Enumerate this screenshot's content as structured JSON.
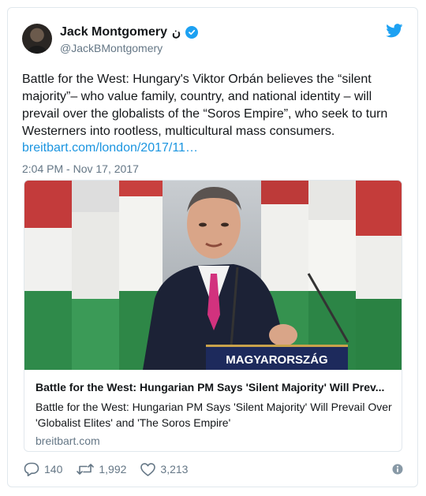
{
  "author": {
    "name": "Jack Montgomery",
    "name_suffix": "ن",
    "handle": "@JackBMontgomery"
  },
  "tweet": {
    "text": "Battle for the West: Hungary's Viktor Orbán believes the “silent majority”– who value family, country, and national identity – will prevail over the globalists of the “Soros Empire”, who seek to turn Westerners into rootless, multicultural mass consumers.",
    "link": "breitbart.com/london/2017/11…",
    "timestamp": "2:04 PM - Nov 17, 2017"
  },
  "card": {
    "podium_text": "MAGYARORSZÁG",
    "title": "Battle for the West: Hungarian PM Says 'Silent Majority' Will Prev...",
    "description": "Battle for the West: Hungarian PM Says 'Silent Majority' Will Prevail Over 'Globalist Elites' and 'The Soros Empire'",
    "domain": "breitbart.com"
  },
  "actions": {
    "replies": "140",
    "retweets": "1,992",
    "likes": "3,213"
  },
  "icons": {
    "verified": "verified-badge-icon",
    "bird": "twitter-bird-icon",
    "reply": "reply-icon",
    "retweet": "retweet-icon",
    "like": "heart-icon",
    "info": "info-icon"
  },
  "colors": {
    "accent": "#1da1f2",
    "link": "#1b95e0",
    "muted": "#657786"
  }
}
